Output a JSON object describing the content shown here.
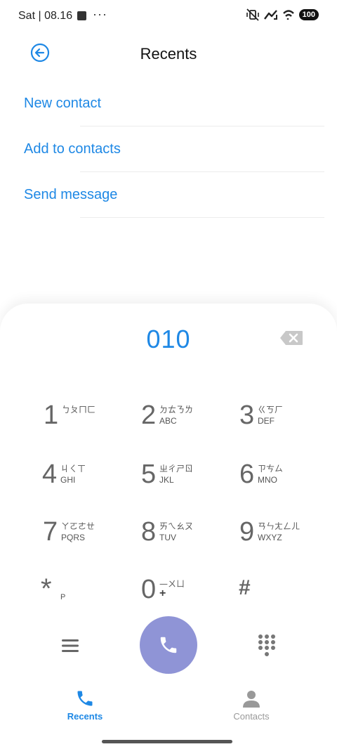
{
  "status_bar": {
    "time": "Sat | 08.16",
    "dots": "···",
    "battery": "100"
  },
  "header": {
    "title": "Recents"
  },
  "actions": [
    {
      "label": "New contact"
    },
    {
      "label": "Add to contacts"
    },
    {
      "label": "Send message"
    }
  ],
  "dialer": {
    "number": "010",
    "keys": [
      {
        "digit": "1",
        "zhuyin": "ㄅㄆㄇㄈ",
        "letters": ""
      },
      {
        "digit": "2",
        "zhuyin": "ㄉㄊㄋㄌ",
        "letters": "ABC"
      },
      {
        "digit": "3",
        "zhuyin": "ㄍㄎㄏ",
        "letters": "DEF"
      },
      {
        "digit": "4",
        "zhuyin": "ㄐㄑㄒ",
        "letters": "GHI"
      },
      {
        "digit": "5",
        "zhuyin": "ㄓㄔㄕㄖ",
        "letters": "JKL"
      },
      {
        "digit": "6",
        "zhuyin": "ㄗㄘㄙ",
        "letters": "MNO"
      },
      {
        "digit": "7",
        "zhuyin": "ㄚㄛㄜㄝ",
        "letters": "PQRS"
      },
      {
        "digit": "8",
        "zhuyin": "ㄞㄟㄠㄡ",
        "letters": "TUV"
      },
      {
        "digit": "9",
        "zhuyin": "ㄢㄣㄤㄥㄦ",
        "letters": "WXYZ"
      },
      {
        "digit": "*",
        "sub": "P"
      },
      {
        "digit": "0",
        "zhuyin": "—ㄨㄩ",
        "plus": "+"
      },
      {
        "digit": "#"
      }
    ]
  },
  "nav": {
    "recents": "Recents",
    "contacts": "Contacts"
  },
  "colors": {
    "accent": "#1e88e5",
    "call_button": "#8f94d6"
  }
}
